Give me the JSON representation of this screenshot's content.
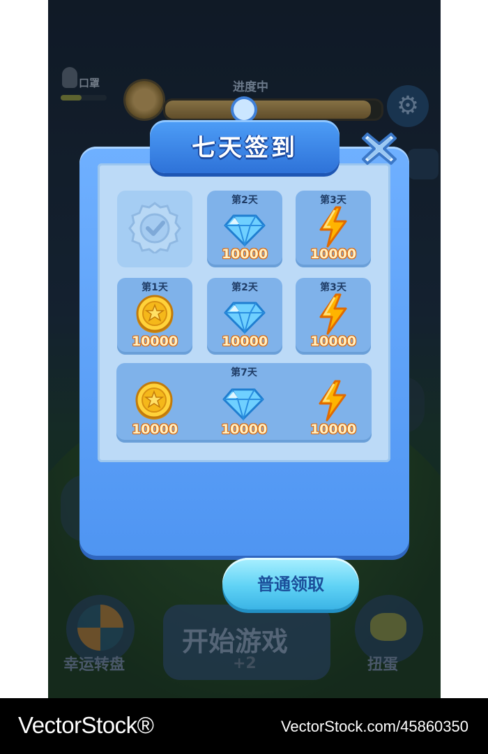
{
  "hud": {
    "player_name": "口罩",
    "timer_label": "进度中"
  },
  "popup": {
    "title": "七天签到",
    "claim_button": "普通领取",
    "cells": [
      {
        "day": "",
        "reward": "checkmark",
        "amount": "",
        "claimed": true
      },
      {
        "day": "第2天",
        "reward": "diamond",
        "amount": "10000"
      },
      {
        "day": "第3天",
        "reward": "energy",
        "amount": "10000"
      },
      {
        "day": "第1天",
        "reward": "coin",
        "amount": "10000"
      },
      {
        "day": "第2天",
        "reward": "diamond",
        "amount": "10000"
      },
      {
        "day": "第3天",
        "reward": "energy",
        "amount": "10000"
      }
    ],
    "big_reward": {
      "day": "第7天",
      "items": [
        {
          "reward": "coin",
          "amount": "10000"
        },
        {
          "reward": "diamond",
          "amount": "10000"
        },
        {
          "reward": "energy",
          "amount": "10000"
        }
      ]
    }
  },
  "background_ui": {
    "lucky_wheel_label": "幸运转盘",
    "start_button_label": "开始游戏",
    "start_button_sub": "+2",
    "gacha_label": "扭蛋"
  },
  "watermark": {
    "brand": "VectorStock®",
    "id": "VectorStock.com/45860350"
  }
}
